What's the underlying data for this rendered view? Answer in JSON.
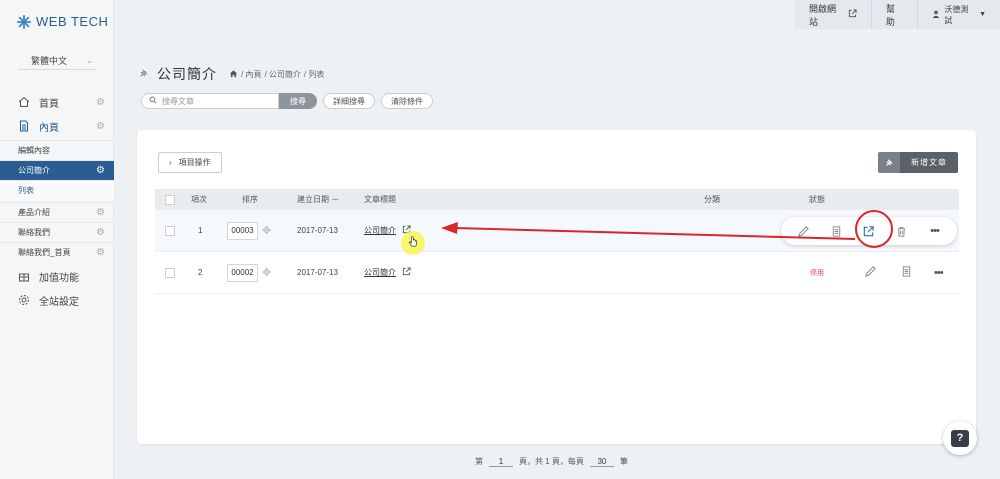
{
  "brand": {
    "name": "WEB TECH",
    "color": "#2a5e8c"
  },
  "sidebar": {
    "language": "繁體中文",
    "items": [
      {
        "label": "首頁",
        "icon": "home-icon"
      },
      {
        "label": "內頁",
        "icon": "page-icon"
      },
      {
        "label": "編輯內容"
      },
      {
        "label": "公司簡介"
      },
      {
        "label": "列表"
      },
      {
        "label": "產品介紹"
      },
      {
        "label": "聯絡我們"
      },
      {
        "label": "聯絡我們_首頁"
      },
      {
        "label": "加值功能",
        "icon": "gift-icon"
      },
      {
        "label": "全站設定",
        "icon": "gear-icon"
      }
    ]
  },
  "topbar": {
    "open_site": "開啟網站",
    "help": "幫助",
    "user": "沃德測試"
  },
  "header": {
    "title": "公司簡介",
    "crumbs": [
      "/ 內頁",
      "/ 公司簡介",
      "/ 列表"
    ]
  },
  "search": {
    "placeholder": "搜尋文章",
    "button": "搜尋",
    "advanced": "詳細搜尋",
    "clear": "清除條件"
  },
  "toolbar": {
    "project_ops": "項目操作",
    "new_article": "新增文章"
  },
  "table": {
    "columns": [
      "項次",
      "排序",
      "建立日期 －",
      "文章標題",
      "分類",
      "狀態"
    ],
    "rows": [
      {
        "index": "1",
        "order": "00003",
        "date": "2017-07-13",
        "title": "公司簡介",
        "status": ""
      },
      {
        "index": "2",
        "order": "00002",
        "date": "2017-07-13",
        "title": "公司簡介",
        "status": "停用"
      }
    ]
  },
  "pager": {
    "prefix": "第",
    "page": "1",
    "mid": "頁，共 1 頁，每頁",
    "per_page": "30",
    "suffix": "筆"
  },
  "help_fab": "?",
  "colors": {
    "selected": "#2b5d92",
    "annotation": "#d9262b",
    "danger": "#e04a4a"
  }
}
